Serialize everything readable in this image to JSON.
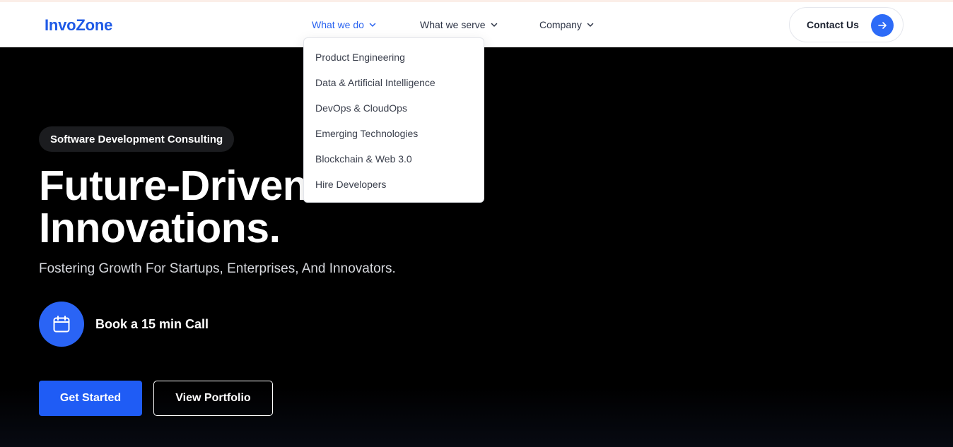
{
  "brand": {
    "logo": "InvoZone",
    "accent_color": "#1f5cf5"
  },
  "nav": {
    "items": [
      {
        "label": "What we do",
        "active": true
      },
      {
        "label": "What we serve",
        "active": false
      },
      {
        "label": "Company",
        "active": false
      }
    ],
    "contact_label": "Contact Us",
    "contact_icon": "arrow-right-icon"
  },
  "dropdown": {
    "items": [
      {
        "label": "Product Engineering"
      },
      {
        "label": "Data & Artificial Intelligence"
      },
      {
        "label": "DevOps & CloudOps"
      },
      {
        "label": "Emerging Technologies"
      },
      {
        "label": "Blockchain & Web 3.0"
      },
      {
        "label": "Hire Developers"
      }
    ]
  },
  "hero": {
    "tag": "Software Development Consulting",
    "title_line1": "Future-Driven",
    "title_line2": "Innovations.",
    "subtitle": "Fostering Growth For Startups, Enterprises, And Innovators.",
    "call_label": "Book a 15 min Call",
    "call_icon": "calendar-icon",
    "primary_cta": "Get Started",
    "secondary_cta": "View Portfolio"
  }
}
